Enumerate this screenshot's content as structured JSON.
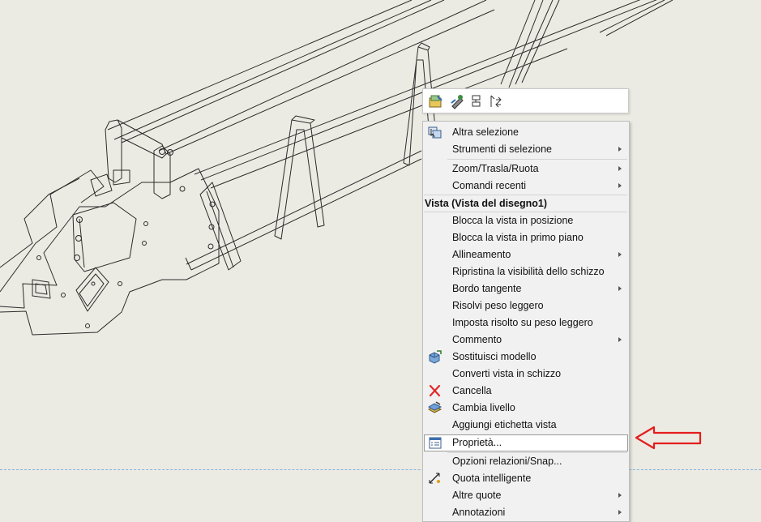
{
  "colors": {
    "background": "#ecebe3",
    "menu_background": "#f1f1f1",
    "annotation_arrow": "#e31e1e",
    "delete_icon": "#e02a2a",
    "dashed_line": "#7eb4dc"
  },
  "toolbar": {
    "buttons": [
      {
        "icon": "open-drawing-icon"
      },
      {
        "icon": "edit-sketch-icon"
      },
      {
        "icon": "align-icon"
      },
      {
        "icon": "flip-icon"
      }
    ]
  },
  "menu": {
    "items_top": [
      {
        "label": "Altra selezione",
        "icon": "select-other-icon",
        "submenu": false
      },
      {
        "label": "Strumenti di selezione",
        "submenu": true
      },
      {
        "label": "Zoom/Trasla/Ruota",
        "submenu": true
      },
      {
        "label": "Comandi recenti",
        "submenu": true
      }
    ],
    "section_header": "Vista (Vista del disegno1)",
    "items_view": [
      {
        "label": "Blocca la vista in posizione",
        "submenu": false
      },
      {
        "label": "Blocca la vista in primo piano",
        "submenu": false
      },
      {
        "label": "Allineamento",
        "submenu": true
      },
      {
        "label": "Ripristina la visibilità dello schizzo",
        "submenu": false
      },
      {
        "label": "Bordo tangente",
        "submenu": true
      },
      {
        "label": "Risolvi peso leggero",
        "submenu": false
      },
      {
        "label": "Imposta risolto su peso leggero",
        "submenu": false
      },
      {
        "label": "Commento",
        "submenu": true
      },
      {
        "label": "Sostituisci modello",
        "icon": "replace-model-icon",
        "submenu": false
      },
      {
        "label": "Converti vista in schizzo",
        "submenu": false
      },
      {
        "label": "Cancella",
        "icon": "delete-icon",
        "submenu": false
      },
      {
        "label": "Cambia livello",
        "icon": "change-layer-icon",
        "submenu": false
      },
      {
        "label": "Aggiungi etichetta vista",
        "submenu": false
      },
      {
        "label": "Proprietà...",
        "icon": "properties-icon",
        "submenu": false,
        "highlighted": true
      }
    ],
    "items_bottom": [
      {
        "label": "Opzioni relazioni/Snap...",
        "submenu": false
      },
      {
        "label": "Quota intelligente",
        "icon": "smart-dimension-icon",
        "submenu": false
      },
      {
        "label": "Altre quote",
        "submenu": true
      },
      {
        "label": "Annotazioni",
        "submenu": true
      }
    ]
  }
}
